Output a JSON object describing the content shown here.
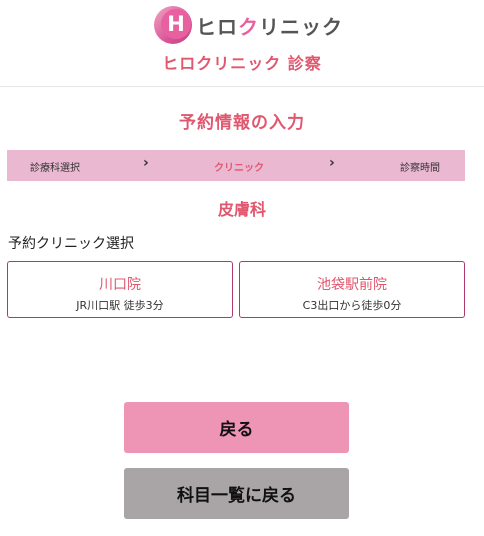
{
  "header": {
    "logo_letter": "H",
    "logo_text_part1": "ヒロ",
    "logo_text_accent": "ク",
    "logo_text_part2": "リニック",
    "subtitle": "ヒロクリニック 診察"
  },
  "page_title": "予約情報の入力",
  "steps": {
    "items": [
      {
        "label": "診療科選択"
      },
      {
        "label": "クリニック"
      },
      {
        "label": "診察時間"
      }
    ],
    "separator": "›"
  },
  "department": "皮膚科",
  "section_label": "予約クリニック選択",
  "clinics": [
    {
      "name": "川口院",
      "access": "JR川口駅 徒歩3分"
    },
    {
      "name": "池袋駅前院",
      "access": "C3出口から徒歩0分"
    }
  ],
  "buttons": {
    "back": "戻る",
    "back_to_list": "科目一覧に戻る"
  },
  "colors": {
    "accent": "#e0576e",
    "step_bar": "#ebb8d2",
    "card_border": "#b0396f",
    "back_button": "#ee94b4",
    "list_button": "#a9a5a7"
  }
}
